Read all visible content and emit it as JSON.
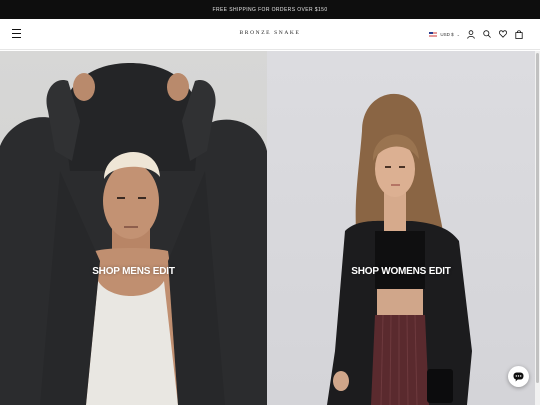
{
  "announcement": {
    "text": "FREE SHIPPING FOR ORDERS OVER $150"
  },
  "header": {
    "brand": "BRONZE SNAKE",
    "currency": {
      "label": "USD $",
      "flag": "us-flag-icon"
    },
    "icons": [
      "menu-icon",
      "account-icon",
      "search-icon",
      "wishlist-icon",
      "cart-icon"
    ]
  },
  "hero": {
    "men": {
      "label": "SHOP MENS EDIT"
    },
    "women": {
      "label": "SHOP WOMENS EDIT"
    }
  },
  "chat": {
    "icon": "chat-icon"
  },
  "colors": {
    "announce_bg": "#0e0e0e",
    "text_dark": "#111111",
    "hero_text": "#ffffff"
  }
}
